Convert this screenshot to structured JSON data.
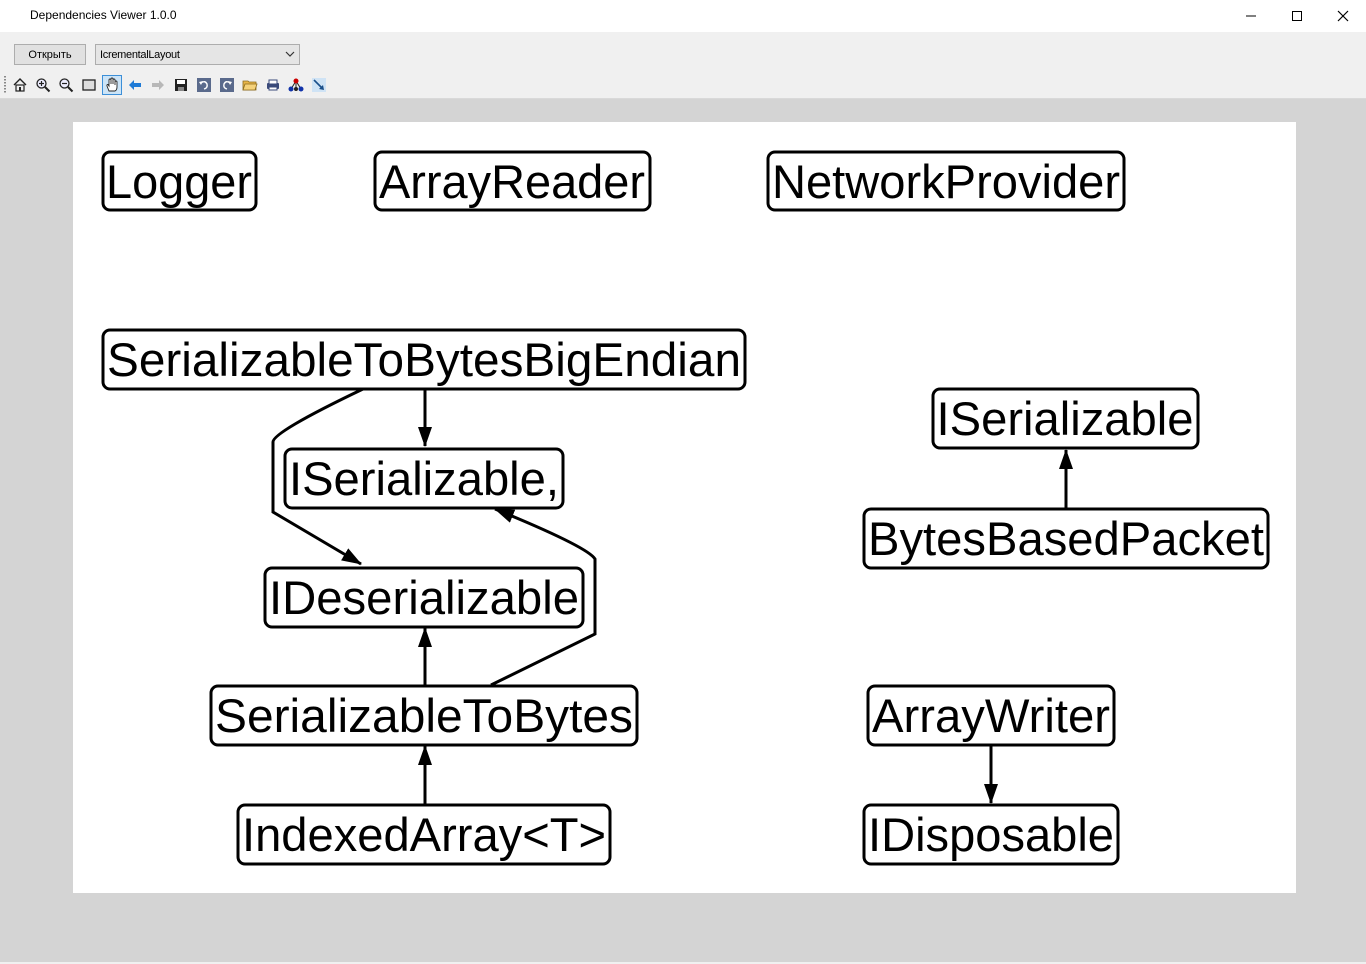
{
  "window": {
    "title": "Dependencies Viewer 1.0.0",
    "controls": [
      "minimize-icon",
      "maximize-icon",
      "close-icon"
    ]
  },
  "toolbar": {
    "open_label": "Открыть",
    "layout_value": "IcrementalLayout",
    "icons": [
      "home-icon",
      "zoom-in-icon",
      "zoom-out-icon",
      "rectangle-select-icon",
      "pan-hand-icon",
      "back-arrow-icon",
      "forward-arrow-icon",
      "save-icon",
      "undo-icon",
      "redo-icon",
      "open-folder-icon",
      "print-icon",
      "graph-layout-icon",
      "edge-tool-icon"
    ],
    "active_icon": "pan-hand-icon"
  },
  "graph": {
    "nodes": {
      "logger": "Logger",
      "array_reader": "ArrayReader",
      "network_provider": "NetworkProvider",
      "serializable_big_endian": "SerializableToBytesBigEndian",
      "iserializable_comma": "ISerializable,",
      "ideserializable": "IDeserializable",
      "serializable_to_bytes": "SerializableToBytes",
      "indexed_array": "IndexedArray<T>",
      "iserializable": "ISerializable",
      "bytes_based_packet": "BytesBasedPacket",
      "array_writer": "ArrayWriter",
      "idisposable": "IDisposable"
    },
    "edges": [
      {
        "from": "SerializableToBytesBigEndian",
        "to": "ISerializable,"
      },
      {
        "from": "SerializableToBytesBigEndian",
        "to": "IDeserializable"
      },
      {
        "from": "SerializableToBytes",
        "to": "IDeserializable"
      },
      {
        "from": "SerializableToBytes",
        "to": "ISerializable,"
      },
      {
        "from": "IndexedArray<T>",
        "to": "SerializableToBytes"
      },
      {
        "from": "BytesBasedPacket",
        "to": "ISerializable"
      },
      {
        "from": "ArrayWriter",
        "to": "IDisposable"
      }
    ]
  }
}
